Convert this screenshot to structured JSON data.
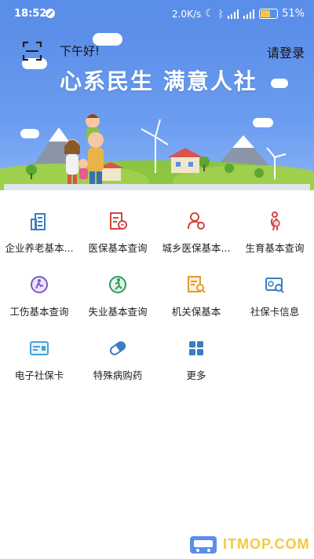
{
  "status_bar": {
    "time": "18:52",
    "speed": "2.0K/s",
    "battery": "51%"
  },
  "header": {
    "greeting": "下午好!",
    "login": "请登录",
    "slogan": "心系民生  满意人社"
  },
  "grid": {
    "items": [
      {
        "label": "企业养老基本...",
        "icon": "building-icon",
        "color": "#3a7cc2"
      },
      {
        "label": "医保基本查询",
        "icon": "medical-card-icon",
        "color": "#d0453e"
      },
      {
        "label": "城乡医保基本...",
        "icon": "person-search-icon",
        "color": "#d0453e"
      },
      {
        "label": "生育基本查询",
        "icon": "pregnant-icon",
        "color": "#d0453e"
      },
      {
        "label": "工伤基本查询",
        "icon": "injury-icon",
        "color": "#7b5bc7"
      },
      {
        "label": "失业基本查询",
        "icon": "running-person-icon",
        "color": "#2f9a5a"
      },
      {
        "label": "机关保基本",
        "icon": "document-search-icon",
        "color": "#e59a2b"
      },
      {
        "label": "社保卡信息",
        "icon": "card-search-icon",
        "color": "#3a7cc2"
      },
      {
        "label": "电子社保卡",
        "icon": "e-card-icon",
        "color": "#4aa3d6"
      },
      {
        "label": "特殊病购药",
        "icon": "capsule-icon",
        "color": "#3a7cc2"
      },
      {
        "label": "更多",
        "icon": "more-grid-icon",
        "color": "#3a7cc2"
      }
    ]
  },
  "watermark": {
    "text": "ITMOP.COM"
  }
}
